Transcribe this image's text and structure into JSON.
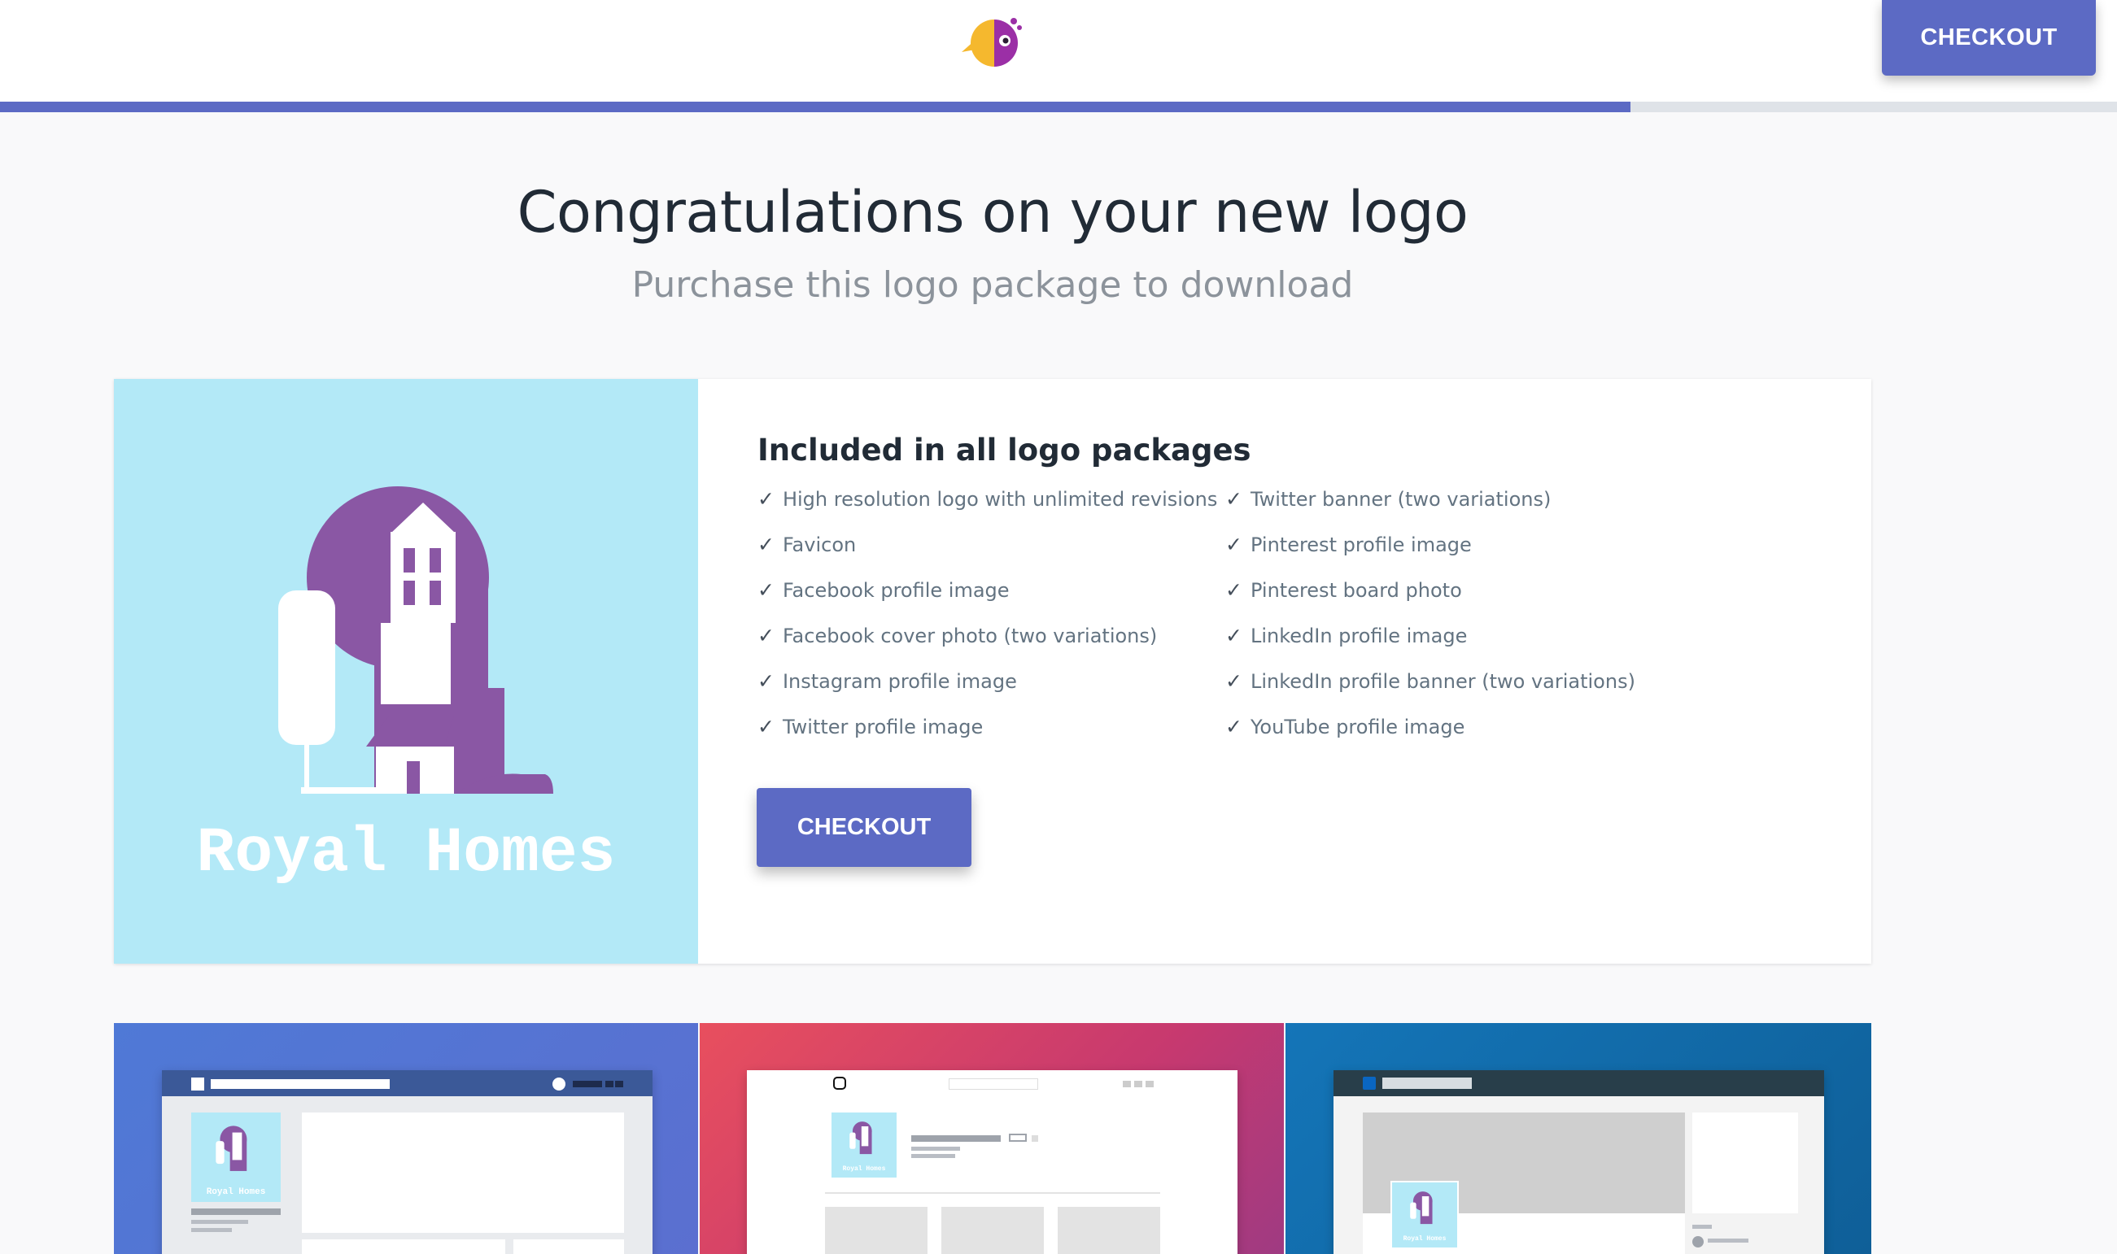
{
  "header": {
    "checkout_label": "CHECKOUT",
    "logo_icon": "parrot-logo-icon",
    "progress_fraction": 0.77
  },
  "hero": {
    "title": "Congratulations on your new logo",
    "subtitle": "Purchase this logo package to download"
  },
  "package": {
    "title": "Included in all logo packages",
    "check_glyph": "✓",
    "features_left": [
      "High resolution logo with unlimited revisions",
      "Favicon",
      "Facebook profile image",
      "Facebook cover photo (two variations)",
      "Instagram profile image",
      "Twitter profile image"
    ],
    "features_right": [
      "Twitter banner (two variations)",
      "Pinterest profile image",
      "Pinterest board photo",
      "LinkedIn profile image",
      "LinkedIn profile banner (two variations)",
      "YouTube profile image"
    ],
    "checkout_label": "CHECKOUT"
  },
  "logo_preview": {
    "brand_name": "Royal Homes",
    "background": "#b3e9f7",
    "primary_color": "#8a57a4"
  },
  "mockups": [
    {
      "platform": "facebook",
      "brand_name": "Royal Homes",
      "icon": "facebook-mockup-icon"
    },
    {
      "platform": "instagram",
      "brand_name": "Royal Homes",
      "icon": "instagram-icon"
    },
    {
      "platform": "linkedin",
      "brand_name": "Royal Homes",
      "icon": "linkedin-mockup-icon"
    }
  ],
  "colors": {
    "accent": "#5c6ac4",
    "text_dark": "#212b36",
    "text_muted": "#637381"
  }
}
